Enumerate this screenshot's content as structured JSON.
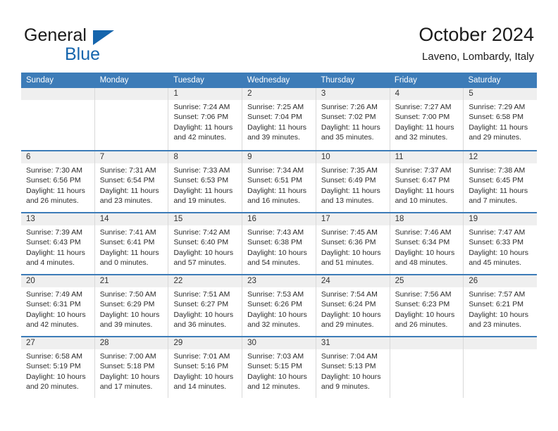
{
  "brand": {
    "word_general": "General",
    "word_blue": "Blue",
    "triangle_icon": "brand-triangle-icon",
    "accent_color": "#1565ad"
  },
  "header": {
    "title": "October 2024",
    "subtitle": "Laveno, Lombardy, Italy"
  },
  "theme": {
    "header_row_bg": "#3d7cb8",
    "date_band_bg": "#efefef",
    "cell_border": "#d9d9d9",
    "text_color": "#2b2b2b"
  },
  "day_headers": [
    "Sunday",
    "Monday",
    "Tuesday",
    "Wednesday",
    "Thursday",
    "Friday",
    "Saturday"
  ],
  "weeks": [
    [
      {
        "date": "",
        "empty": true,
        "lines": []
      },
      {
        "date": "",
        "empty": true,
        "lines": []
      },
      {
        "date": "1",
        "lines": [
          "Sunrise: 7:24 AM",
          "Sunset: 7:06 PM",
          "Daylight: 11 hours",
          "and 42 minutes."
        ]
      },
      {
        "date": "2",
        "lines": [
          "Sunrise: 7:25 AM",
          "Sunset: 7:04 PM",
          "Daylight: 11 hours",
          "and 39 minutes."
        ]
      },
      {
        "date": "3",
        "lines": [
          "Sunrise: 7:26 AM",
          "Sunset: 7:02 PM",
          "Daylight: 11 hours",
          "and 35 minutes."
        ]
      },
      {
        "date": "4",
        "lines": [
          "Sunrise: 7:27 AM",
          "Sunset: 7:00 PM",
          "Daylight: 11 hours",
          "and 32 minutes."
        ]
      },
      {
        "date": "5",
        "lines": [
          "Sunrise: 7:29 AM",
          "Sunset: 6:58 PM",
          "Daylight: 11 hours",
          "and 29 minutes."
        ]
      }
    ],
    [
      {
        "date": "6",
        "lines": [
          "Sunrise: 7:30 AM",
          "Sunset: 6:56 PM",
          "Daylight: 11 hours",
          "and 26 minutes."
        ]
      },
      {
        "date": "7",
        "lines": [
          "Sunrise: 7:31 AM",
          "Sunset: 6:54 PM",
          "Daylight: 11 hours",
          "and 23 minutes."
        ]
      },
      {
        "date": "8",
        "lines": [
          "Sunrise: 7:33 AM",
          "Sunset: 6:53 PM",
          "Daylight: 11 hours",
          "and 19 minutes."
        ]
      },
      {
        "date": "9",
        "lines": [
          "Sunrise: 7:34 AM",
          "Sunset: 6:51 PM",
          "Daylight: 11 hours",
          "and 16 minutes."
        ]
      },
      {
        "date": "10",
        "lines": [
          "Sunrise: 7:35 AM",
          "Sunset: 6:49 PM",
          "Daylight: 11 hours",
          "and 13 minutes."
        ]
      },
      {
        "date": "11",
        "lines": [
          "Sunrise: 7:37 AM",
          "Sunset: 6:47 PM",
          "Daylight: 11 hours",
          "and 10 minutes."
        ]
      },
      {
        "date": "12",
        "lines": [
          "Sunrise: 7:38 AM",
          "Sunset: 6:45 PM",
          "Daylight: 11 hours",
          "and 7 minutes."
        ]
      }
    ],
    [
      {
        "date": "13",
        "lines": [
          "Sunrise: 7:39 AM",
          "Sunset: 6:43 PM",
          "Daylight: 11 hours",
          "and 4 minutes."
        ]
      },
      {
        "date": "14",
        "lines": [
          "Sunrise: 7:41 AM",
          "Sunset: 6:41 PM",
          "Daylight: 11 hours",
          "and 0 minutes."
        ]
      },
      {
        "date": "15",
        "lines": [
          "Sunrise: 7:42 AM",
          "Sunset: 6:40 PM",
          "Daylight: 10 hours",
          "and 57 minutes."
        ]
      },
      {
        "date": "16",
        "lines": [
          "Sunrise: 7:43 AM",
          "Sunset: 6:38 PM",
          "Daylight: 10 hours",
          "and 54 minutes."
        ]
      },
      {
        "date": "17",
        "lines": [
          "Sunrise: 7:45 AM",
          "Sunset: 6:36 PM",
          "Daylight: 10 hours",
          "and 51 minutes."
        ]
      },
      {
        "date": "18",
        "lines": [
          "Sunrise: 7:46 AM",
          "Sunset: 6:34 PM",
          "Daylight: 10 hours",
          "and 48 minutes."
        ]
      },
      {
        "date": "19",
        "lines": [
          "Sunrise: 7:47 AM",
          "Sunset: 6:33 PM",
          "Daylight: 10 hours",
          "and 45 minutes."
        ]
      }
    ],
    [
      {
        "date": "20",
        "lines": [
          "Sunrise: 7:49 AM",
          "Sunset: 6:31 PM",
          "Daylight: 10 hours",
          "and 42 minutes."
        ]
      },
      {
        "date": "21",
        "lines": [
          "Sunrise: 7:50 AM",
          "Sunset: 6:29 PM",
          "Daylight: 10 hours",
          "and 39 minutes."
        ]
      },
      {
        "date": "22",
        "lines": [
          "Sunrise: 7:51 AM",
          "Sunset: 6:27 PM",
          "Daylight: 10 hours",
          "and 36 minutes."
        ]
      },
      {
        "date": "23",
        "lines": [
          "Sunrise: 7:53 AM",
          "Sunset: 6:26 PM",
          "Daylight: 10 hours",
          "and 32 minutes."
        ]
      },
      {
        "date": "24",
        "lines": [
          "Sunrise: 7:54 AM",
          "Sunset: 6:24 PM",
          "Daylight: 10 hours",
          "and 29 minutes."
        ]
      },
      {
        "date": "25",
        "lines": [
          "Sunrise: 7:56 AM",
          "Sunset: 6:23 PM",
          "Daylight: 10 hours",
          "and 26 minutes."
        ]
      },
      {
        "date": "26",
        "lines": [
          "Sunrise: 7:57 AM",
          "Sunset: 6:21 PM",
          "Daylight: 10 hours",
          "and 23 minutes."
        ]
      }
    ],
    [
      {
        "date": "27",
        "lines": [
          "Sunrise: 6:58 AM",
          "Sunset: 5:19 PM",
          "Daylight: 10 hours",
          "and 20 minutes."
        ]
      },
      {
        "date": "28",
        "lines": [
          "Sunrise: 7:00 AM",
          "Sunset: 5:18 PM",
          "Daylight: 10 hours",
          "and 17 minutes."
        ]
      },
      {
        "date": "29",
        "lines": [
          "Sunrise: 7:01 AM",
          "Sunset: 5:16 PM",
          "Daylight: 10 hours",
          "and 14 minutes."
        ]
      },
      {
        "date": "30",
        "lines": [
          "Sunrise: 7:03 AM",
          "Sunset: 5:15 PM",
          "Daylight: 10 hours",
          "and 12 minutes."
        ]
      },
      {
        "date": "31",
        "lines": [
          "Sunrise: 7:04 AM",
          "Sunset: 5:13 PM",
          "Daylight: 10 hours",
          "and 9 minutes."
        ]
      },
      {
        "date": "",
        "empty": true,
        "lines": []
      },
      {
        "date": "",
        "empty": true,
        "lines": []
      }
    ]
  ]
}
